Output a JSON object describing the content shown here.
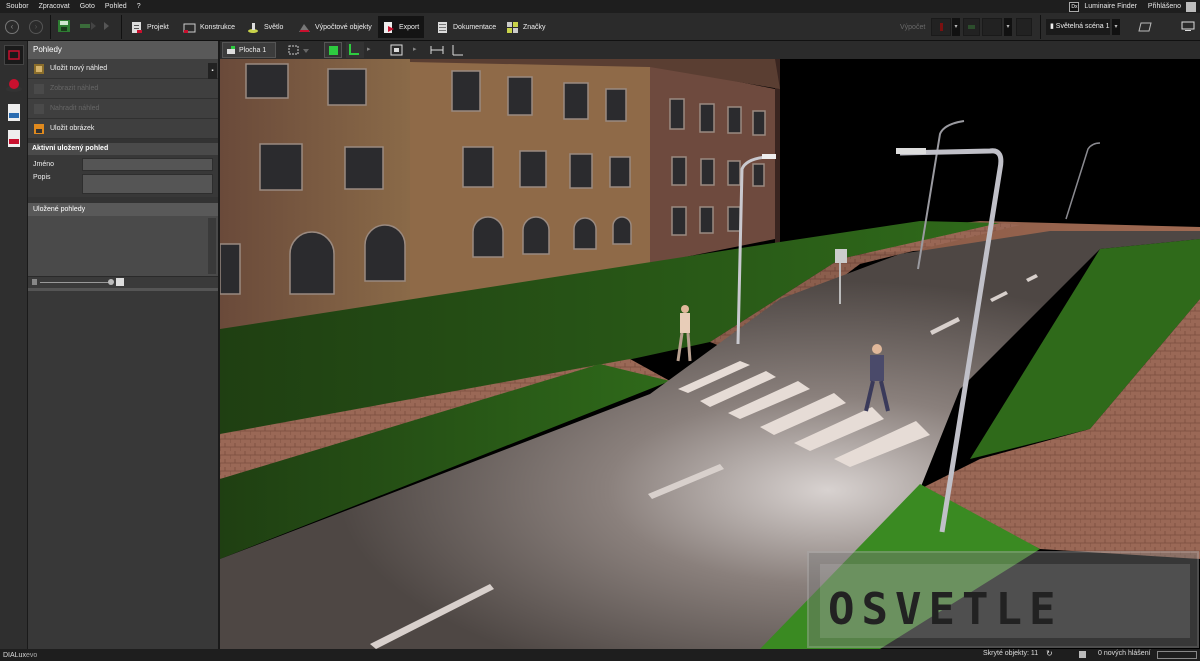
{
  "menu": [
    "Soubor",
    "Zpracovat",
    "Goto",
    "Pohled",
    "?"
  ],
  "menu_right": {
    "luminaire_finder": "Luminaire Finder",
    "login": "Přihlášeno",
    "badge": "Dx"
  },
  "toolbar": {
    "tabs": [
      {
        "label": "Projekt",
        "icon": "project-icon"
      },
      {
        "label": "Konstrukce",
        "icon": "construction-icon"
      },
      {
        "label": "Světlo",
        "icon": "light-icon"
      },
      {
        "label": "Výpočtové objekty",
        "icon": "calc-objects-icon"
      },
      {
        "label": "Export",
        "icon": "export-icon",
        "active": true
      },
      {
        "label": "Dokumentace",
        "icon": "documentation-icon"
      },
      {
        "label": "Značky",
        "icon": "marks-icon"
      }
    ],
    "compute_label": "Výpočet",
    "scene": "Světelná scéna 1"
  },
  "panel": {
    "title": "Pohledy",
    "actions": [
      {
        "label": "Uložit nový náhled",
        "enabled": true
      },
      {
        "label": "Zobrazit náhled",
        "enabled": false
      },
      {
        "label": "Nahradit náhled",
        "enabled": false
      },
      {
        "label": "Uložit obrázek",
        "enabled": true
      }
    ],
    "active_view": {
      "header": "Aktivní uložený pohled",
      "name_label": "Jméno",
      "desc_label": "Popis",
      "name_value": "",
      "desc_value": ""
    },
    "saved_views": {
      "header": "Uložené pohledy"
    }
  },
  "viewport_tab": "Plocha 1",
  "watermark": "OSVETLE",
  "status": {
    "app_prefix": "DIALux",
    "app_suffix": "evo",
    "hidden_objects": "Skryté objekty: 11",
    "messages": "0 nových hlášení"
  },
  "colors": {
    "accent_red": "#c8102e",
    "toolbar_bg": "#2b2b2b",
    "panel_bg": "#383838",
    "green_btn": "#2ecc40"
  }
}
